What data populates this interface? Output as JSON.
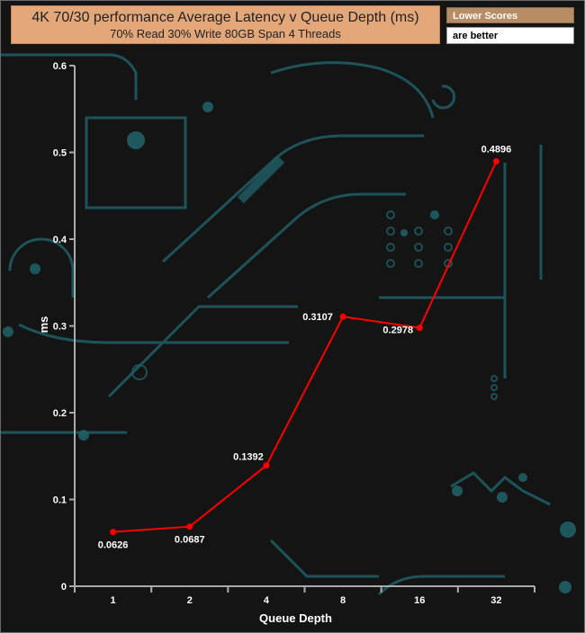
{
  "title": {
    "line1": "4K 70/30 performance Average Latency v Queue Depth (ms)",
    "line2": "70% Read 30% Write 80GB Span 4 Threads"
  },
  "legend": {
    "line1": "Lower Scores",
    "line2": "are better"
  },
  "colors": {
    "series": "#ff0000",
    "title_bg": "#e3a77a",
    "background": "#141414",
    "circuit": "#1f5f66"
  },
  "chart_data": {
    "type": "line",
    "title": "4K 70/30 performance Average Latency v Queue Depth (ms)",
    "subtitle": "70% Read 30% Write 80GB Span 4 Threads",
    "xlabel": "Queue Depth",
    "ylabel": "ms",
    "categories": [
      "1",
      "2",
      "4",
      "8",
      "16",
      "32"
    ],
    "series": [
      {
        "values": [
          0.0626,
          0.0687,
          0.1392,
          0.3107,
          0.2978,
          0.4896
        ]
      }
    ],
    "data_labels": [
      "0.0626",
      "0.0687",
      "0.1392",
      "0.3107",
      "0.2978",
      "0.4896"
    ],
    "y_ticks": [
      "0",
      "0.1",
      "0.2",
      "0.3",
      "0.4",
      "0.5",
      "0.6"
    ],
    "ylim": [
      0,
      0.6
    ],
    "grid": false
  }
}
